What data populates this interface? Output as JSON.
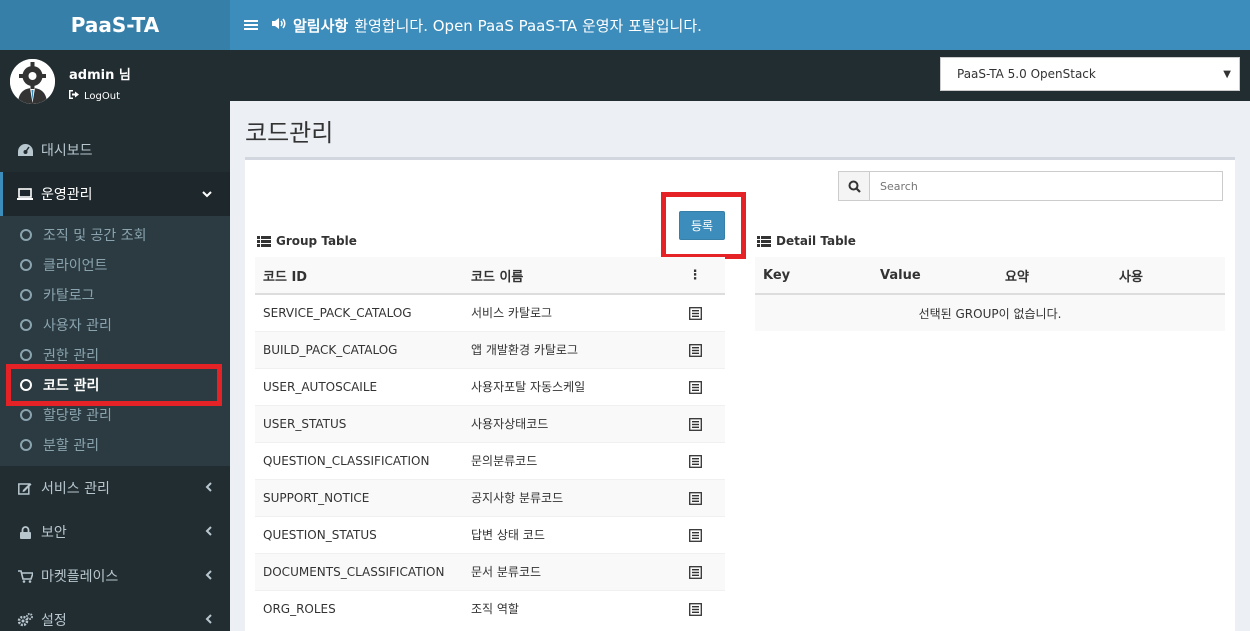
{
  "brand": "PaaS-TA",
  "header": {
    "notice_label": "알림사항",
    "notice_text": "환영합니다. Open PaaS PaaS-TA 운영자 포탈입니다."
  },
  "user": {
    "name": "admin 님",
    "logout_label": "LogOut"
  },
  "environment": {
    "selected": "PaaS-TA 5.0 OpenStack"
  },
  "sidebar": {
    "dashboard": "대시보드",
    "operations": "운영관리",
    "sub_items": [
      "조직 및 공간 조회",
      "클라이언트",
      "카탈로그",
      "사용자 관리",
      "권한 관리",
      "코드 관리",
      "할당량 관리",
      "분할 관리"
    ],
    "services": "서비스 관리",
    "security": "보안",
    "marketplace": "마켓플레이스",
    "settings": "설정"
  },
  "page": {
    "title": "코드관리",
    "search_placeholder": "Search",
    "register_label": "등록"
  },
  "group_table": {
    "title": "Group Table",
    "col_id": "코드 ID",
    "col_name": "코드 이름",
    "col_menu": "⋮",
    "rows": [
      {
        "id": "SERVICE_PACK_CATALOG",
        "name": "서비스 카탈로그"
      },
      {
        "id": "BUILD_PACK_CATALOG",
        "name": "앱 개발환경 카탈로그"
      },
      {
        "id": "USER_AUTOSCAILE",
        "name": "사용자포탈 자동스케일"
      },
      {
        "id": "USER_STATUS",
        "name": "사용자상태코드"
      },
      {
        "id": "QUESTION_CLASSIFICATION",
        "name": "문의분류코드"
      },
      {
        "id": "SUPPORT_NOTICE",
        "name": "공지사항 분류코드"
      },
      {
        "id": "QUESTION_STATUS",
        "name": "답변 상태 코드"
      },
      {
        "id": "DOCUMENTS_CLASSIFICATION",
        "name": "문서 분류코드"
      },
      {
        "id": "ORG_ROLES",
        "name": "조직 역할"
      }
    ]
  },
  "detail_table": {
    "title": "Detail Table",
    "col_key": "Key",
    "col_value": "Value",
    "col_summary": "요약",
    "col_use": "사용",
    "empty_message": "선택된 GROUP이 없습니다."
  },
  "colors": {
    "primary": "#3c8dbc",
    "brand_bg": "#367fa9",
    "sidebar_bg": "#222d32",
    "highlight": "#e52226"
  }
}
